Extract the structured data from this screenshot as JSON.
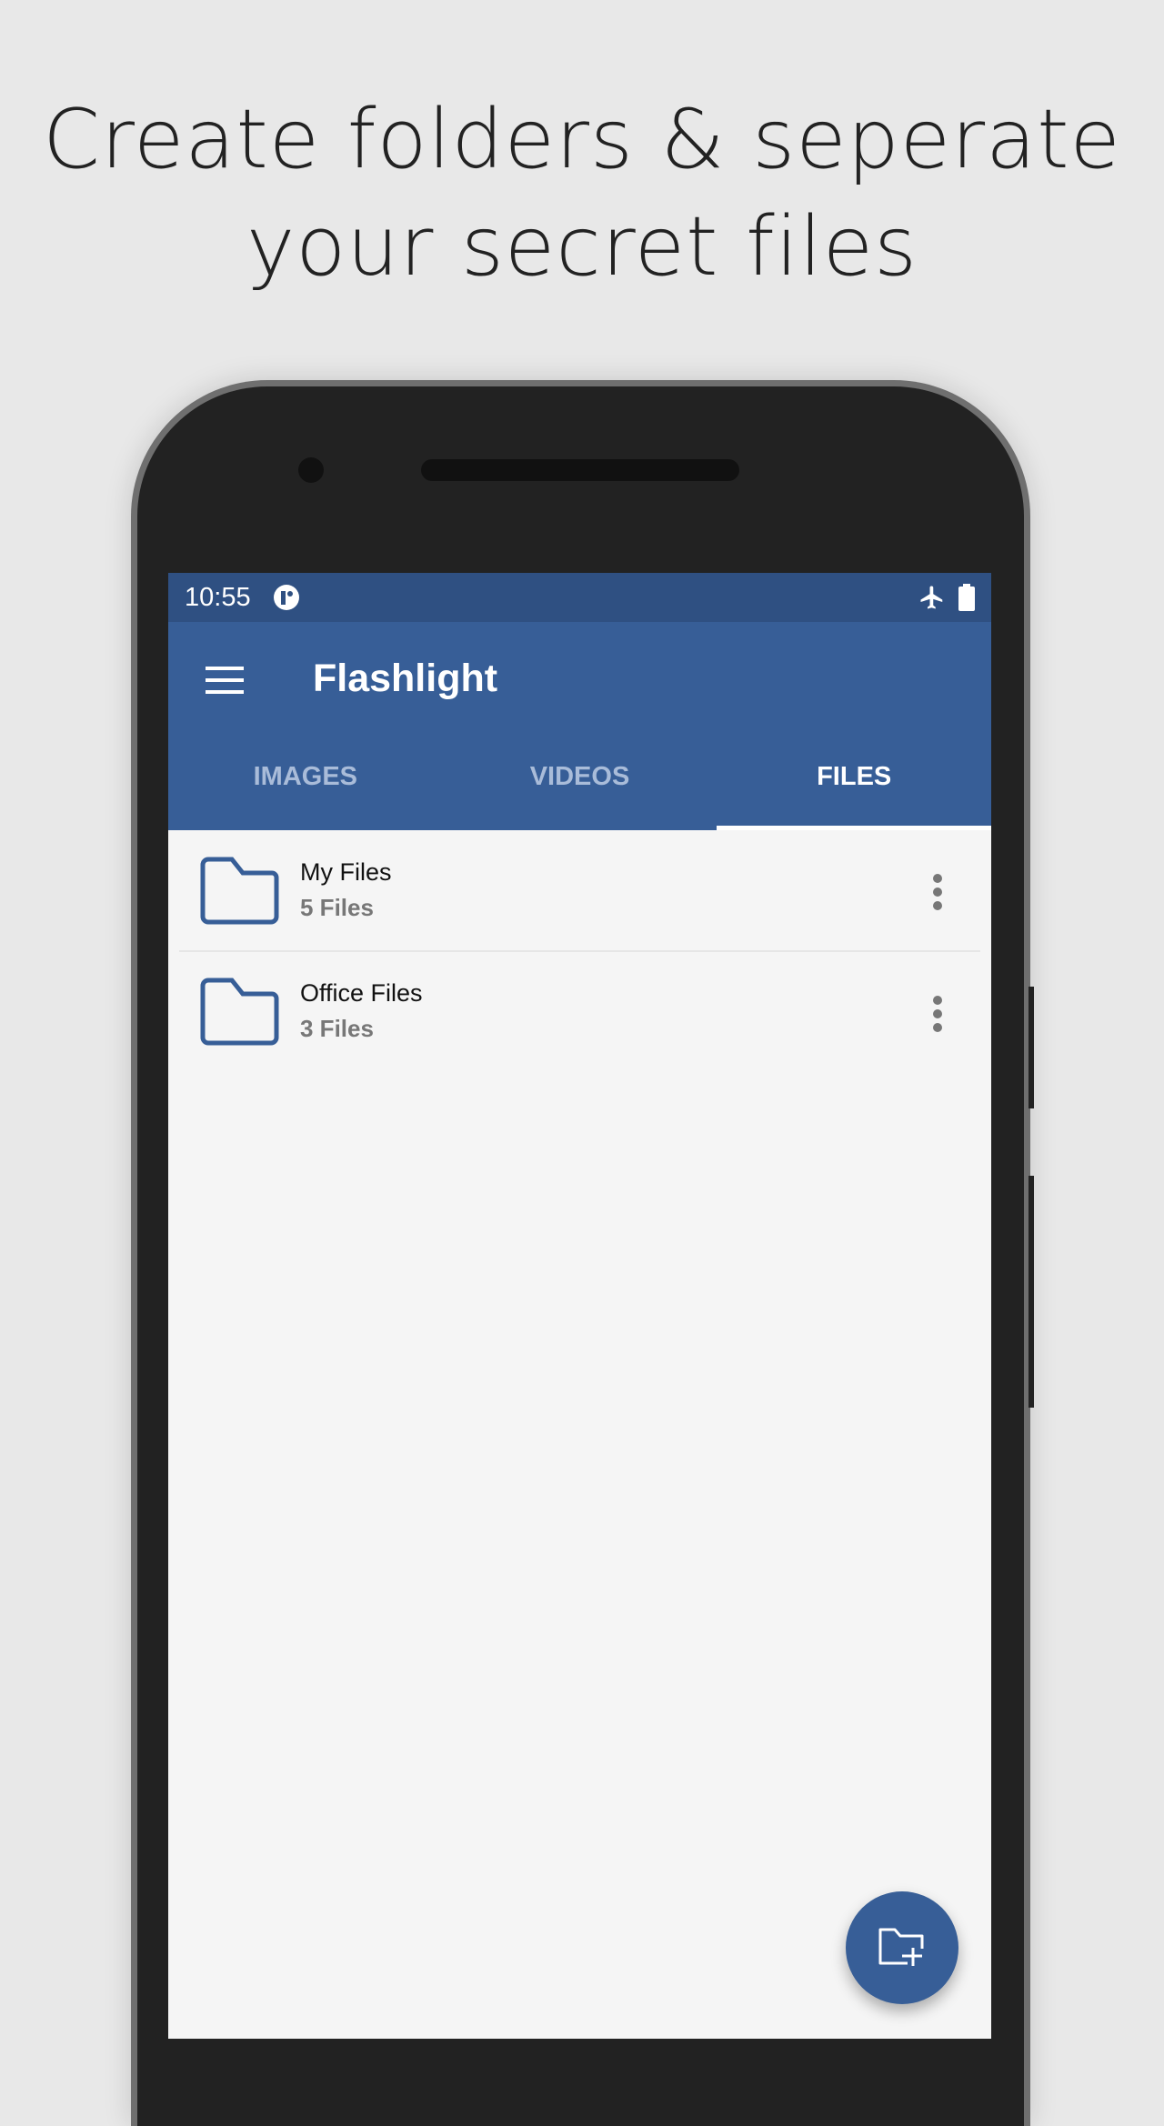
{
  "headline": {
    "line1": "Create folders & seperate",
    "line2": "your secret files"
  },
  "status_bar": {
    "time": "10:55",
    "icons": [
      "app-notification-icon",
      "airplane-mode-icon",
      "battery-icon"
    ]
  },
  "app_bar": {
    "title": "Flashlight",
    "menu_icon": "hamburger-menu-icon"
  },
  "tabs": [
    {
      "label": "IMAGES",
      "active": false
    },
    {
      "label": "VIDEOS",
      "active": false
    },
    {
      "label": "FILES",
      "active": true
    }
  ],
  "folders": [
    {
      "name": "My Files",
      "count": "5 Files"
    },
    {
      "name": "Office Files",
      "count": "3 Files"
    }
  ],
  "fab": {
    "icon": "create-folder-icon"
  },
  "colors": {
    "primary": "#375e97",
    "status_bar": "#2f5082",
    "background": "#f5f5f5",
    "page_bg": "#e8e8e8"
  }
}
